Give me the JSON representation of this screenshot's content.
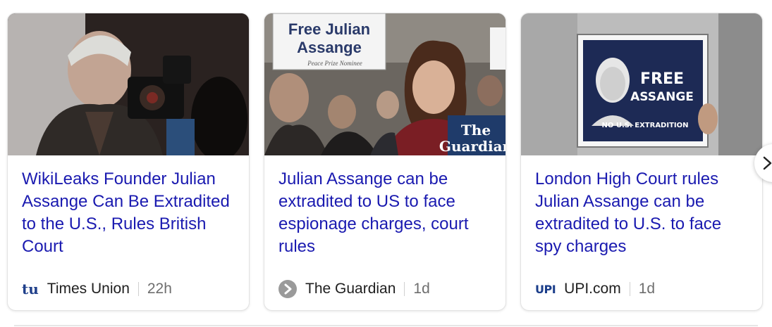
{
  "cards": [
    {
      "headline": "WikiLeaks Founder Julian Assange Can Be Extradited to the U.S., Rules British Court",
      "source": "Times Union",
      "source_logo_text": "tu",
      "time": "22h"
    },
    {
      "headline": "Julian Assange can be extradited to US to face espionage charges, court rules",
      "source": "The Guardian",
      "time": "1d",
      "image_text": {
        "sign_line1": "Free Julian",
        "sign_line2": "Assange",
        "sign_small": "Peace Prize Nominee",
        "watermark_line1": "The",
        "watermark_line2": "Guardian"
      }
    },
    {
      "headline": "London High Court rules Julian Assange can be extradited to U.S. to face spy charges",
      "source": "UPI.com",
      "source_logo_text": "UPI",
      "time": "1d",
      "image_text": {
        "sign_line1": "FREE",
        "sign_line2": "ASSANGE",
        "sign_line3": "NO U.S. EXTRADITION"
      }
    }
  ],
  "navigation": {
    "next_icon": "chevron-right-icon"
  },
  "colors": {
    "headline": "#1a1ab0",
    "source_text": "#202020",
    "time_text": "#6e6e6e",
    "card_border": "#e3e3e3"
  }
}
